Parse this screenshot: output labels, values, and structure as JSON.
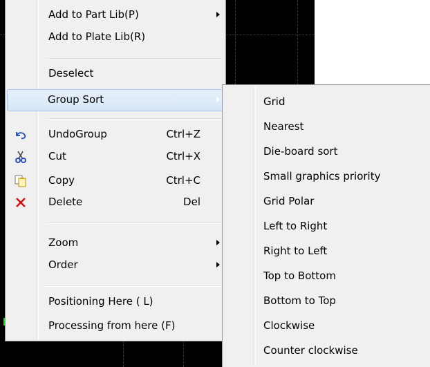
{
  "context_menu": {
    "items": [
      {
        "label": "Add to Part Lib(P)",
        "shortcut": "",
        "submenu": true
      },
      {
        "label": "Add to Plate Lib(R)",
        "shortcut": "",
        "submenu": false
      },
      {
        "label": "Deselect",
        "shortcut": "",
        "submenu": false
      },
      {
        "label": "Group Sort",
        "shortcut": "",
        "submenu": true,
        "highlighted": true
      },
      {
        "label": "UndoGroup",
        "shortcut": "Ctrl+Z",
        "icon": "undo-icon"
      },
      {
        "label": "Cut",
        "shortcut": "Ctrl+X",
        "icon": "scissors-icon"
      },
      {
        "label": "Copy",
        "shortcut": "Ctrl+C",
        "icon": "copy-icon"
      },
      {
        "label": "Delete",
        "shortcut": "Del",
        "icon": "delete-x-icon"
      },
      {
        "label": "Zoom",
        "shortcut": "",
        "submenu": true
      },
      {
        "label": "Order",
        "shortcut": "",
        "submenu": true
      },
      {
        "label": "Positioning Here ( L)",
        "shortcut": ""
      },
      {
        "label": "Processing from here (F)",
        "shortcut": ""
      }
    ]
  },
  "group_sort_submenu": {
    "items": [
      "Grid",
      "Nearest",
      "Die-board sort",
      "Small graphics priority",
      "Grid Polar",
      "Left to Right",
      "Right to Left",
      "Top to Bottom",
      "Bottom to Top",
      "Clockwise",
      "Counter clockwise"
    ]
  },
  "colors": {
    "menu_bg": "#f0f0f0",
    "highlight": "#d6e6f7",
    "canvas_bg": "#000000",
    "selection_dash": "#2bd12b",
    "delete_icon": "#d01010",
    "undo_icon": "#2a5ab8"
  }
}
